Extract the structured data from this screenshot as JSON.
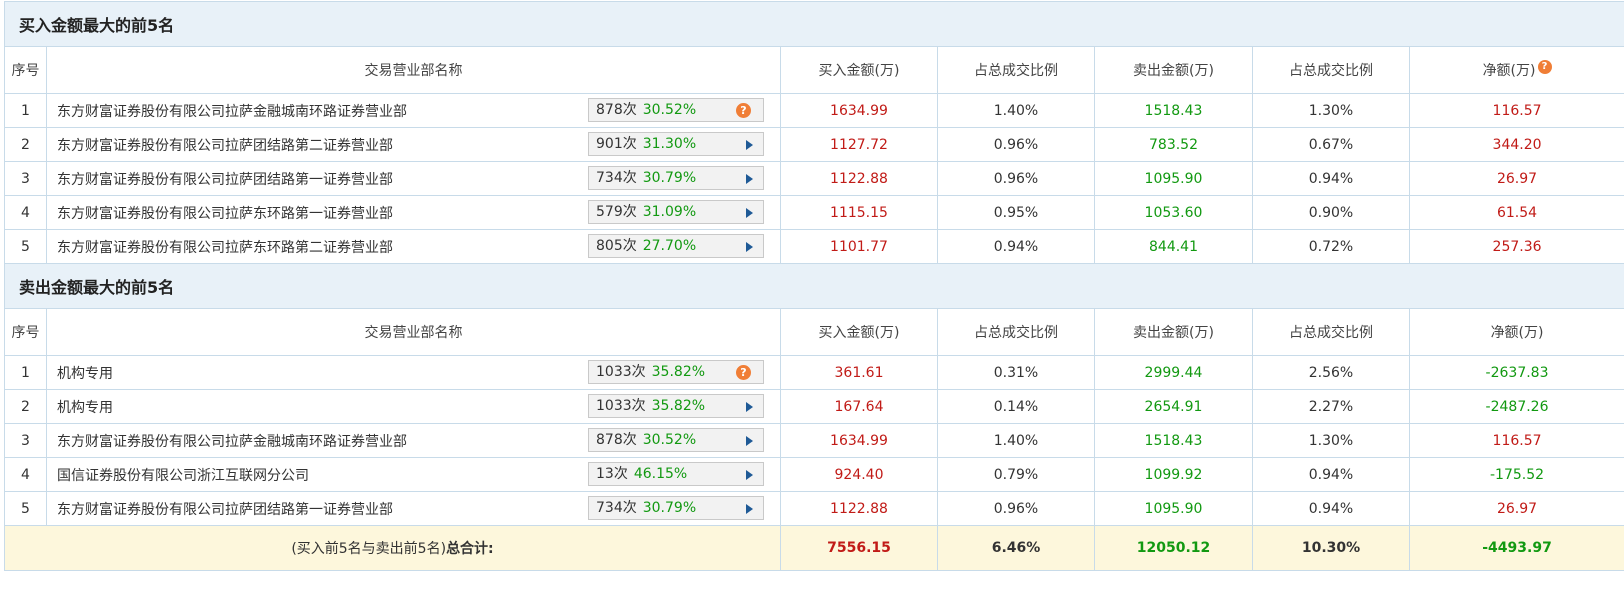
{
  "buy_section": {
    "title": "买入金额最大的前5名",
    "headers": [
      "序号",
      "交易营业部名称",
      "买入金额(万)",
      "占总成交比例",
      "卖出金额(万)",
      "占总成交比例",
      "净额(万)"
    ],
    "rows": [
      {
        "idx": "1",
        "name": "东方财富证券股份有限公司拉萨金融城南环路证券营业部",
        "times": "878次",
        "pct": "30.52%",
        "icon": "question-icon",
        "buy": "1634.99",
        "buy_ratio": "1.40%",
        "sell": "1518.43",
        "sell_ratio": "1.30%",
        "net": "116.57"
      },
      {
        "idx": "2",
        "name": "东方财富证券股份有限公司拉萨团结路第二证券营业部",
        "times": "901次",
        "pct": "31.30%",
        "icon": "arrow-right-icon",
        "buy": "1127.72",
        "buy_ratio": "0.96%",
        "sell": "783.52",
        "sell_ratio": "0.67%",
        "net": "344.20"
      },
      {
        "idx": "3",
        "name": "东方财富证券股份有限公司拉萨团结路第一证券营业部",
        "times": "734次",
        "pct": "30.79%",
        "icon": "arrow-right-icon",
        "buy": "1122.88",
        "buy_ratio": "0.96%",
        "sell": "1095.90",
        "sell_ratio": "0.94%",
        "net": "26.97"
      },
      {
        "idx": "4",
        "name": "东方财富证券股份有限公司拉萨东环路第一证券营业部",
        "times": "579次",
        "pct": "31.09%",
        "icon": "arrow-right-icon",
        "buy": "1115.15",
        "buy_ratio": "0.95%",
        "sell": "1053.60",
        "sell_ratio": "0.90%",
        "net": "61.54"
      },
      {
        "idx": "5",
        "name": "东方财富证券股份有限公司拉萨东环路第二证券营业部",
        "times": "805次",
        "pct": "27.70%",
        "icon": "arrow-right-icon",
        "buy": "1101.77",
        "buy_ratio": "0.94%",
        "sell": "844.41",
        "sell_ratio": "0.72%",
        "net": "257.36"
      }
    ]
  },
  "sell_section": {
    "title": "卖出金额最大的前5名",
    "headers": [
      "序号",
      "交易营业部名称",
      "买入金额(万)",
      "占总成交比例",
      "卖出金额(万)",
      "占总成交比例",
      "净额(万)"
    ],
    "rows": [
      {
        "idx": "1",
        "name": "机构专用",
        "times": "1033次",
        "pct": "35.82%",
        "icon": "question-icon",
        "buy": "361.61",
        "buy_ratio": "0.31%",
        "sell": "2999.44",
        "sell_ratio": "2.56%",
        "net": "-2637.83"
      },
      {
        "idx": "2",
        "name": "机构专用",
        "times": "1033次",
        "pct": "35.82%",
        "icon": "arrow-right-icon",
        "buy": "167.64",
        "buy_ratio": "0.14%",
        "sell": "2654.91",
        "sell_ratio": "2.27%",
        "net": "-2487.26"
      },
      {
        "idx": "3",
        "name": "东方财富证券股份有限公司拉萨金融城南环路证券营业部",
        "times": "878次",
        "pct": "30.52%",
        "icon": "arrow-right-icon",
        "buy": "1634.99",
        "buy_ratio": "1.40%",
        "sell": "1518.43",
        "sell_ratio": "1.30%",
        "net": "116.57"
      },
      {
        "idx": "4",
        "name": "国信证券股份有限公司浙江互联网分公司",
        "times": "13次",
        "pct": "46.15%",
        "icon": "arrow-right-icon",
        "buy": "924.40",
        "buy_ratio": "0.79%",
        "sell": "1099.92",
        "sell_ratio": "0.94%",
        "net": "-175.52"
      },
      {
        "idx": "5",
        "name": "东方财富证券股份有限公司拉萨团结路第一证券营业部",
        "times": "734次",
        "pct": "30.79%",
        "icon": "arrow-right-icon",
        "buy": "1122.88",
        "buy_ratio": "0.96%",
        "sell": "1095.90",
        "sell_ratio": "0.94%",
        "net": "26.97"
      }
    ]
  },
  "total": {
    "label_prefix": "(买入前5名与卖出前5名)",
    "label_bold": "总合计:",
    "buy": "7556.15",
    "buy_ratio": "6.46%",
    "sell": "12050.12",
    "sell_ratio": "10.30%",
    "net": "-4493.97"
  },
  "colors": {
    "buy": "#c11b17",
    "sell": "#129911",
    "header_bg": "#e8f1f8",
    "total_bg": "#fdf7dc",
    "help_icon": "#f07e36"
  }
}
